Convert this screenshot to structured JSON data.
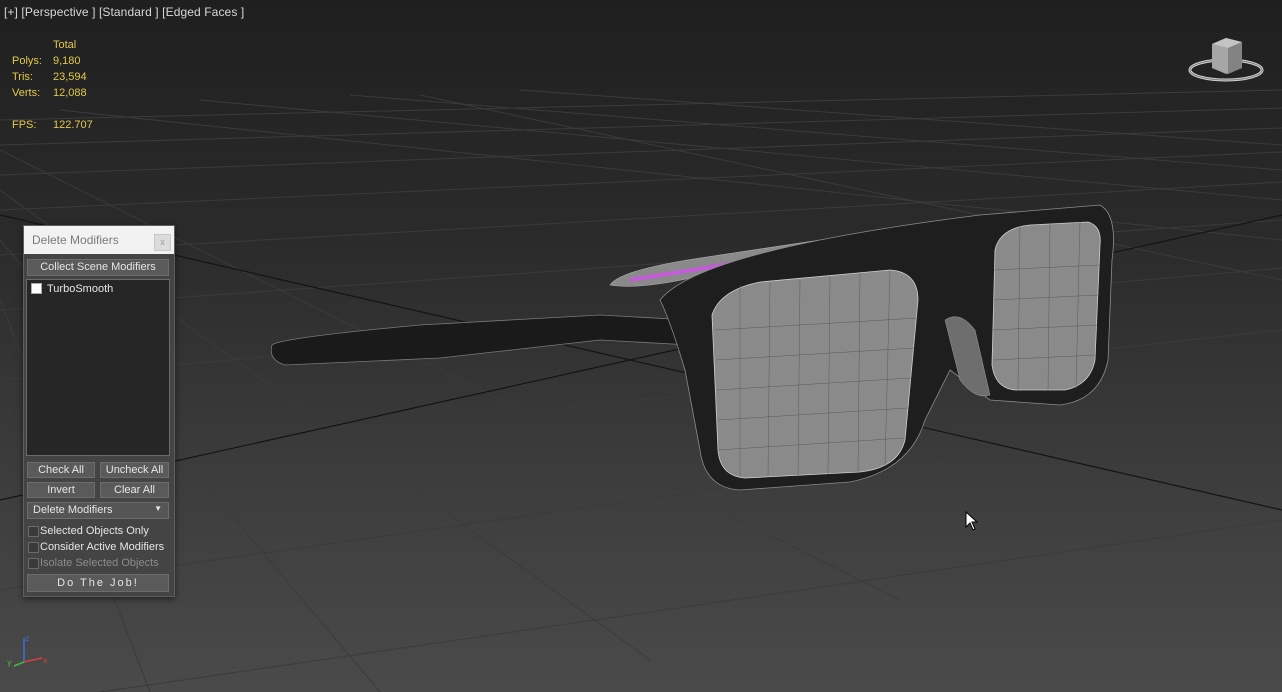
{
  "viewport": {
    "label": "[+] [Perspective ] [Standard ] [Edged Faces ]",
    "stats": {
      "header": "Total",
      "rows": [
        {
          "key": "Polys:",
          "value": "9,180"
        },
        {
          "key": "Tris:",
          "value": "23,594"
        },
        {
          "key": "Verts:",
          "value": "12,088"
        }
      ],
      "fps_key": "FPS:",
      "fps_value": "122.707"
    },
    "colors": {
      "stats_text": "#e2c94a",
      "selection_highlight": "#c45bd8",
      "background": "#2b2b2b"
    }
  },
  "dialog": {
    "title": "Delete Modifiers",
    "close_label": "x",
    "collect_button": "Collect Scene Modifiers",
    "list_items": [
      {
        "label": "TurboSmooth",
        "checked": false
      }
    ],
    "check_all": "Check All",
    "uncheck_all": "Uncheck All",
    "invert": "Invert",
    "clear_all": "Clear All",
    "mode_select": "Delete Modifiers",
    "options": {
      "selected_objects_only": "Selected Objects Only",
      "consider_active_modifiers": "Consider Active Modifiers",
      "isolate_selected_objects": "Isolate Selected Objects"
    },
    "do_job": "Do The Job!"
  },
  "icons": {
    "viewcube": "viewcube-icon",
    "cursor": "mouse-cursor-icon",
    "axis": "axis-tripod-icon",
    "dropdown": "chevron-down-icon"
  }
}
